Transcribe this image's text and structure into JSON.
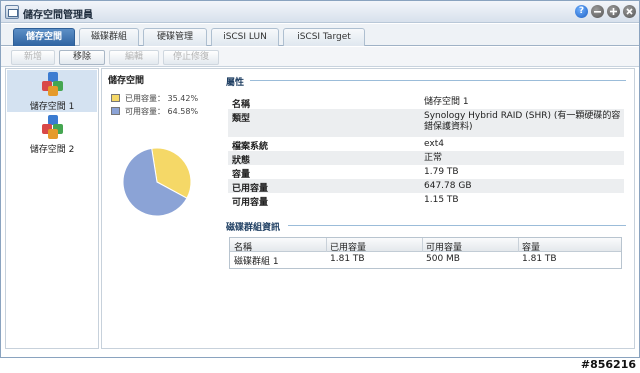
{
  "window": {
    "title": "儲存空間管理員"
  },
  "titlebar_buttons": {
    "help": "?"
  },
  "tabs": [
    {
      "label": "儲存空間"
    },
    {
      "label": "磁碟群組"
    },
    {
      "label": "硬碟管理"
    },
    {
      "label": "iSCSI LUN"
    },
    {
      "label": "iSCSI Target"
    }
  ],
  "toolbar": {
    "create": "新增",
    "remove": "移除",
    "edit": "編輯",
    "stop_repair": "停止修復"
  },
  "sidebar": {
    "items": [
      {
        "label": "儲存空間 1",
        "selected": true
      },
      {
        "label": "儲存空間 2",
        "selected": false
      }
    ]
  },
  "pool": {
    "title": "儲存空間",
    "legend": [
      {
        "label": "已用容量： 35.42%",
        "color": "#f5d867",
        "percent": 35.42
      },
      {
        "label": "可用容量： 64.58%",
        "color": "#8ba3d6",
        "percent": 64.58
      }
    ]
  },
  "properties": {
    "section_title": "屬性",
    "rows": [
      {
        "key": "名稱",
        "value": "儲存空間 1"
      },
      {
        "key": "類型",
        "value": "Synology Hybrid RAID (SHR) (有一顆硬碟的容錯保護資料)"
      },
      {
        "key": "檔案系統",
        "value": "ext4"
      },
      {
        "key": "狀態",
        "value": "正常"
      },
      {
        "key": "容量",
        "value": "1.79 TB"
      },
      {
        "key": "已用容量",
        "value": "647.78 GB"
      },
      {
        "key": "可用容量",
        "value": "1.15 TB"
      }
    ]
  },
  "disk_group": {
    "section_title": "磁碟群組資訊",
    "headers": [
      "名稱",
      "已用容量",
      "可用容量",
      "容量"
    ],
    "rows": [
      [
        "磁碟群組 1",
        "1.81 TB",
        "500 MB",
        "1.81 TB"
      ]
    ]
  },
  "watermark": "#856216"
}
